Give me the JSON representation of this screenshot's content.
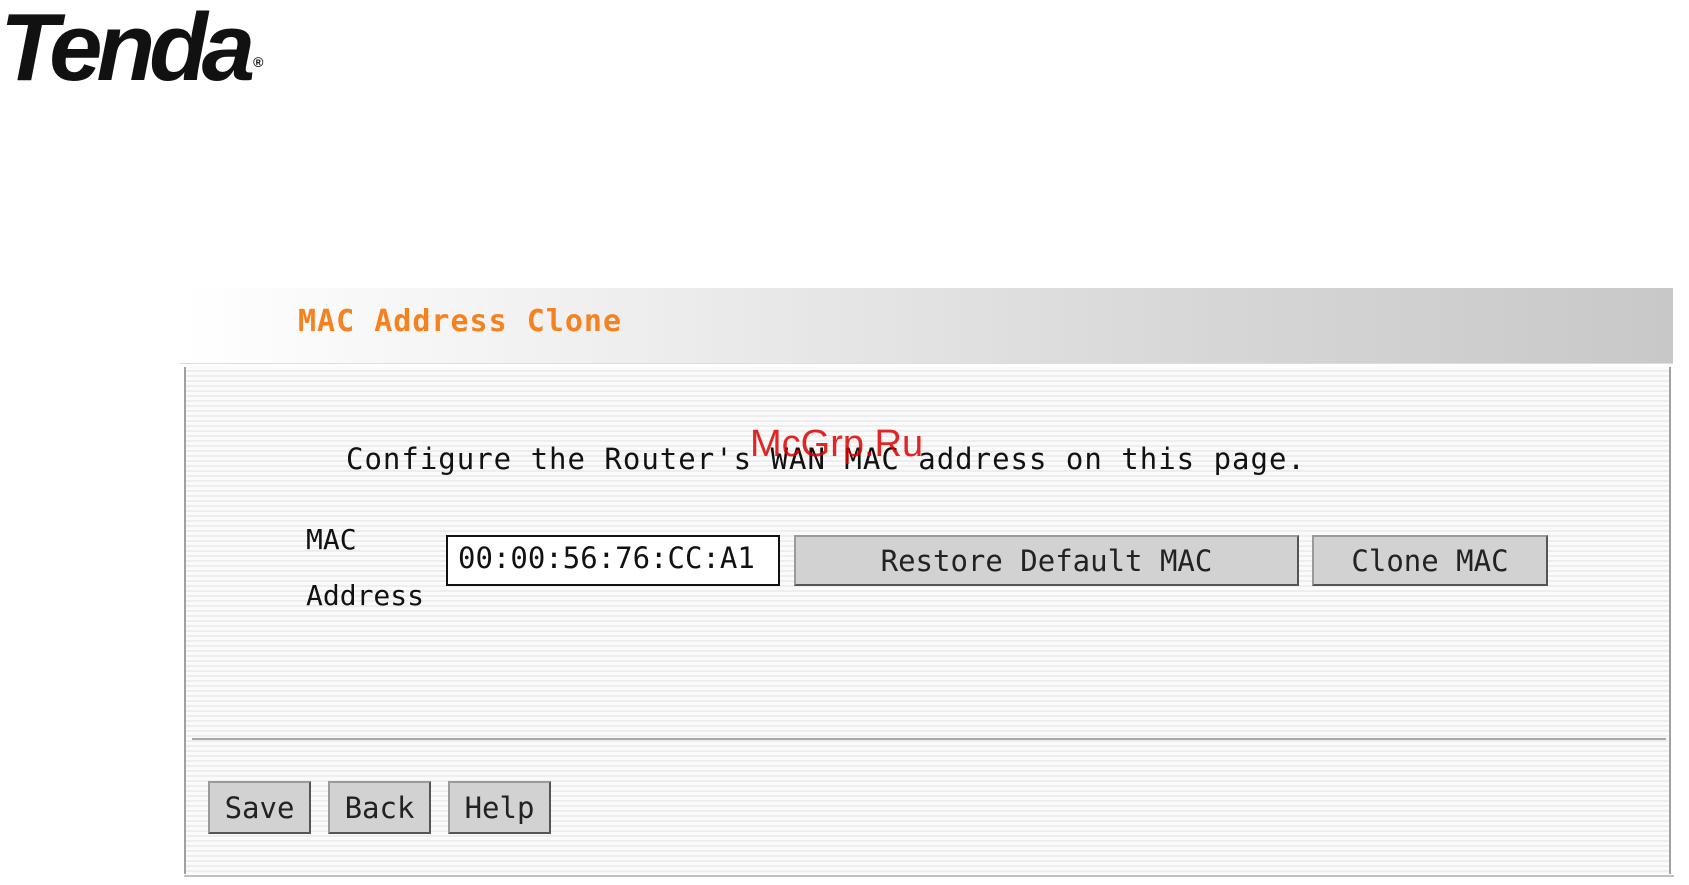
{
  "brand": {
    "logo_text": "Tenda",
    "registered_mark": "®"
  },
  "page": {
    "title": "MAC Address Clone",
    "description": "Configure the Router's WAN MAC address on this page.",
    "watermark": "McGrp.Ru"
  },
  "form": {
    "mac_label_line1": "MAC",
    "mac_label_line2": "Address",
    "mac_value": "00:00:56:76:CC:A1",
    "restore_button": "Restore Default MAC",
    "clone_button": "Clone MAC"
  },
  "actions": {
    "save": "Save",
    "back": "Back",
    "help": "Help"
  },
  "colors": {
    "title": "#f5821f",
    "watermark": "#dd0000"
  }
}
